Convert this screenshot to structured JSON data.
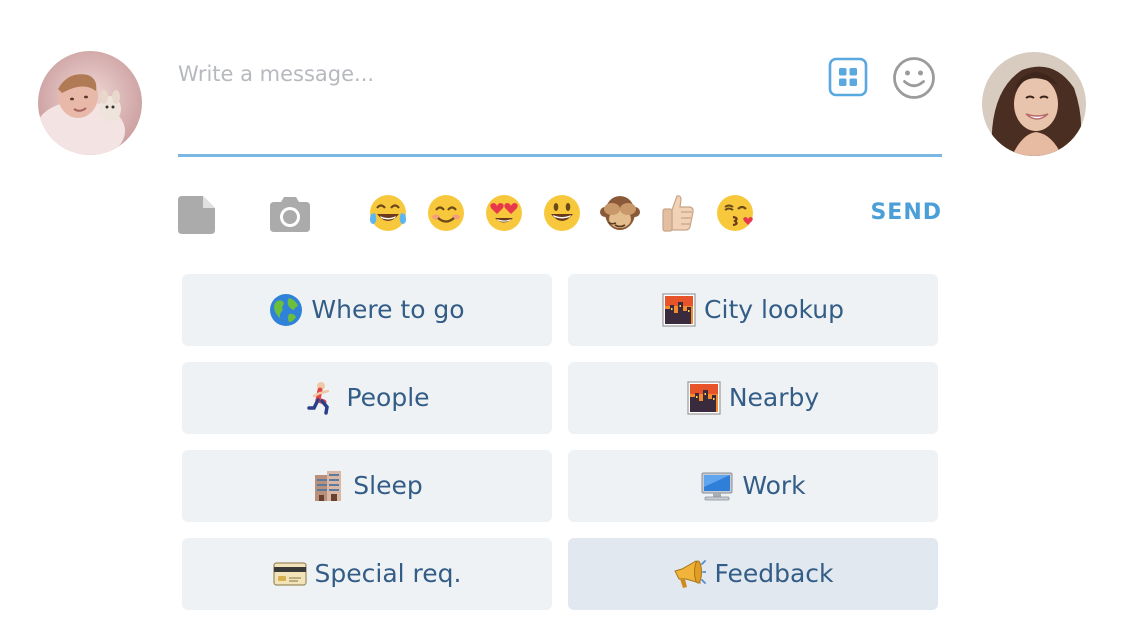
{
  "composer": {
    "placeholder": "Write a message...",
    "send_label": "SEND"
  },
  "toolbar": {
    "icons": [
      "file-icon",
      "camera-icon"
    ],
    "quick_emojis": [
      "joy-emoji",
      "smile-emoji",
      "heart-eyes-emoji",
      "grin-emoji",
      "see-no-evil-monkey-emoji",
      "thumbs-up-emoji",
      "kiss-emoji"
    ]
  },
  "quick_replies": [
    {
      "label": "Where to go",
      "icon": "globe-icon"
    },
    {
      "label": "City lookup",
      "icon": "city-sunset-icon"
    },
    {
      "label": "People",
      "icon": "runner-icon"
    },
    {
      "label": "Nearby",
      "icon": "city-sunset-icon"
    },
    {
      "label": "Sleep",
      "icon": "hotel-icon"
    },
    {
      "label": "Work",
      "icon": "computer-icon"
    },
    {
      "label": "Special req.",
      "icon": "credit-card-icon"
    },
    {
      "label": "Feedback",
      "icon": "megaphone-icon"
    }
  ],
  "colors": {
    "accent": "#4b9fd8",
    "underline": "#7ab8e3",
    "button_bg": "#eff2f5",
    "button_active_bg": "#e1e8f0",
    "button_text": "#335d86"
  }
}
